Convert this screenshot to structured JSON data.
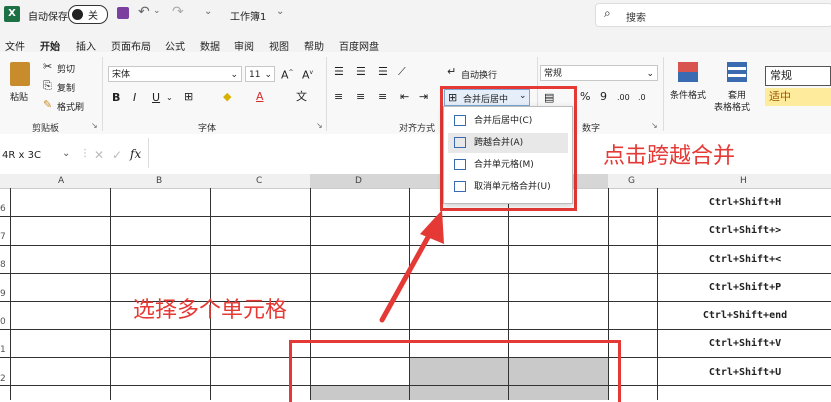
{
  "titlebar": {
    "autosave": "自动保存",
    "toggle": "关",
    "workbook": "工作簿1",
    "search": "搜索"
  },
  "menu": [
    "文件",
    "开始",
    "插入",
    "页面布局",
    "公式",
    "数据",
    "审阅",
    "视图",
    "帮助",
    "百度网盘"
  ],
  "ribbon": {
    "paste": "粘贴",
    "cut": "剪切",
    "copy": "复制",
    "format_painter": "格式刷",
    "clipboard": "剪贴板",
    "font_name": "宋体",
    "font_size": "11",
    "font_group": "字体",
    "align_group": "对齐方式",
    "wrap": "自动换行",
    "merge": "合并后居中",
    "number_format": "常规",
    "number_group": "数字",
    "cond_format": "条件格式",
    "table_format_1": "套用",
    "table_format_2": "表格格式",
    "style_normal": "常规",
    "style_medium": "适中"
  },
  "namebox": "4R x 3C",
  "fx": "fx",
  "columns": [
    "A",
    "B",
    "C",
    "D",
    "G",
    "H"
  ],
  "rows": [
    "6",
    "7",
    "8",
    "9",
    "0",
    "1",
    "2"
  ],
  "shortcuts": [
    "Ctrl+Shift+H",
    "Ctrl+Shift+>",
    "Ctrl+Shift+<",
    "Ctrl+Shift+P",
    "Ctrl+Shift+end",
    "Ctrl+Shift+V",
    "Ctrl+Shift+U"
  ],
  "dropdown": [
    "合并后居中(C)",
    "跨越合并(A)",
    "合并单元格(M)",
    "取消单元格合并(U)"
  ],
  "annotations": {
    "click": "点击跨越合并",
    "select": "选择多个单元格"
  },
  "colors": {
    "accent": "#1d7044",
    "annotation": "#e53935",
    "selection": "#c9c9c9"
  }
}
